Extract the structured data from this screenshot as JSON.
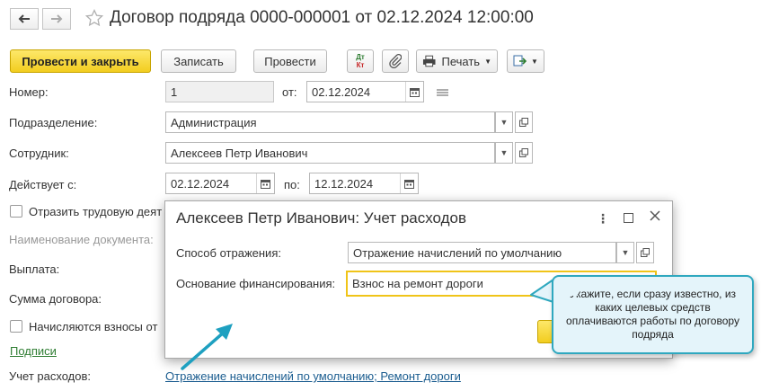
{
  "header": {
    "title": "Договор подряда 0000-000001 от 02.12.2024 12:00:00"
  },
  "toolbar": {
    "post_close": "Провести и закрыть",
    "save": "Записать",
    "post": "Провести",
    "dtkt_top": "Дт",
    "dtkt_bottom": "Кт",
    "print": "Печать"
  },
  "form": {
    "number_label": "Номер:",
    "number_value": "1",
    "date_from_label": "от:",
    "date_value": "02.12.2024",
    "department_label": "Подразделение:",
    "department_value": "Администрация",
    "employee_label": "Сотрудник:",
    "employee_value": "Алексеев Петр Иванович",
    "valid_from_label": "Действует с:",
    "valid_from_value": "02.12.2024",
    "valid_to_label": "по:",
    "valid_to_value": "12.12.2024",
    "labor_check_label": "Отразить трудовую деят",
    "doc_name_label": "Наименование документа:",
    "payment_label": "Выплата:",
    "contract_sum_label": "Сумма договора:",
    "contributions_label": "Начисляются взносы от",
    "signatures_link": "Подписи",
    "expense_label": "Учет расходов:",
    "expense_link": "Отражение начислений по умолчанию; Ремонт дороги"
  },
  "dialog": {
    "title": "Алексеев Петр Иванович: Учет расходов",
    "method_label": "Способ отражения:",
    "method_value": "Отражение начислений по умолчанию",
    "basis_label": "Основание финансирования:",
    "basis_value": "Взнос на ремонт дороги"
  },
  "tooltip": {
    "text": "Укажите, если сразу известно, из каких целевых средств оплачиваются работы по договору подряда"
  },
  "colors": {
    "primary_button": "#f2cd1f",
    "link": "#1a5c8f",
    "tooltip_border": "#2fa8bf",
    "arrow": "#1ea0c0"
  }
}
